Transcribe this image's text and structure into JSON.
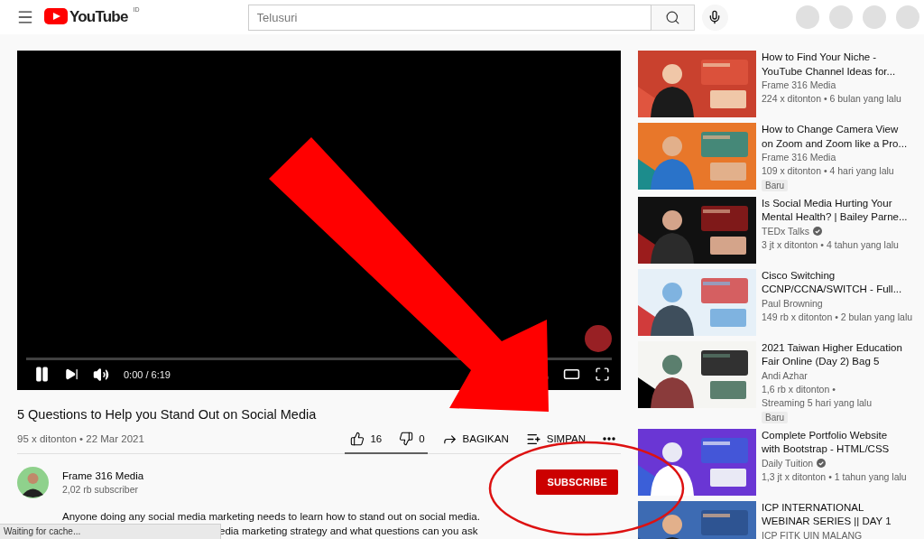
{
  "header": {
    "logo": "YouTube",
    "region": "ID",
    "search": {
      "placeholder": "Telusuri"
    },
    "top_icons": [
      {
        "kind": "placeholder"
      },
      {
        "kind": "placeholder"
      },
      {
        "kind": "placeholder"
      },
      {
        "kind": "placeholder"
      }
    ]
  },
  "player": {
    "playing": true,
    "time": "0:00 / 6:19",
    "progress": {
      "level": 0
    }
  },
  "video": {
    "title": "5 Questions to Help you Stand Out on Social Media",
    "meta": "95 x ditonton • 22 Mar 2021",
    "actions": [
      {
        "kind": "like",
        "label": "16"
      },
      {
        "kind": "dislike",
        "label": "0"
      },
      {
        "kind": "share",
        "label": "BAGIKAN"
      },
      {
        "kind": "save",
        "label": "SIMPAN"
      },
      {
        "kind": "more"
      }
    ],
    "sentiment": {
      "level": 1
    }
  },
  "channel": {
    "name": "Frame 316 Media",
    "subscribers": "2,02 rb subscriber",
    "subscribe": "SUBSCRIBE"
  },
  "description": {
    "lines": [
      "Anyone doing any social media marketing needs to learn how to stand out on social media.",
      "edia marketing strategy and what questions can you ask"
    ]
  },
  "recommendations": [
    {
      "title_lines": [
        "How to Find Your Niche -",
        "YouTube Channel Ideas for..."
      ],
      "channel": "Frame 316 Media",
      "verified": false,
      "meta": "224 x ditonton • 6 bulan yang lalu"
    },
    {
      "title_lines": [
        "How to Change Camera View",
        "on Zoom and Zoom like a Pro..."
      ],
      "channel": "Frame 316 Media",
      "verified": false,
      "meta": "109 x ditonton • 4 hari yang lalu",
      "badge": "Baru"
    },
    {
      "title_lines": [
        "Is Social Media Hurting Your",
        "Mental Health? | Bailey Parne..."
      ],
      "channel": "TEDx Talks",
      "verified": true,
      "meta": "3 jt x ditonton • 4 tahun yang lalu"
    },
    {
      "title_lines": [
        "Cisco Switching",
        "CCNP/CCNA/SWITCH - Full..."
      ],
      "channel": "Paul Browning",
      "verified": false,
      "meta": "149 rb x ditonton • 2 bulan yang lalu"
    },
    {
      "title_lines": [
        "2021 Taiwan Higher Education",
        "Fair Online (Day 2) Bag 5"
      ],
      "channel": "Andi Azhar",
      "verified": false,
      "meta": "1,6 rb x ditonton •",
      "meta_2": "Streaming 5 hari yang lalu",
      "badge": "Baru"
    },
    {
      "title_lines": [
        "Complete Portfolio Website",
        "with Bootstrap - HTML/CSS"
      ],
      "channel": "Daily Tuition",
      "verified": true,
      "meta": "1,3 jt x ditonton • 1 tahun yang lalu"
    },
    {
      "title_lines": [
        "ICP INTERNATIONAL",
        "WEBINAR SERIES || DAY 1"
      ],
      "channel": "ICP FITK UIN MALANG",
      "verified": false
    }
  ],
  "status_bar": "Waiting for cache...",
  "annotations": {
    "arrow": true,
    "ellipse": true
  }
}
